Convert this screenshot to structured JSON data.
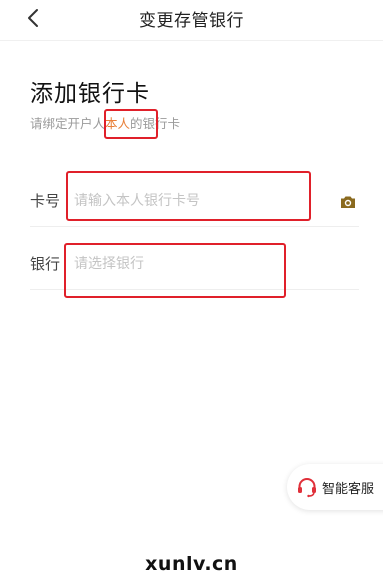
{
  "header": {
    "title": "变更存管银行",
    "back_icon": "chevron-left-icon"
  },
  "section": {
    "heading": "添加银行卡",
    "subtitle_prefix": "请绑定开户人",
    "subtitle_highlight": "本人",
    "subtitle_suffix": "的银行卡",
    "highlight_color": "#e8803a"
  },
  "form": {
    "card_label": "卡号",
    "card_placeholder": "请输入本人银行卡号",
    "card_value": "",
    "camera_icon": "camera-icon",
    "bank_label": "银行",
    "bank_placeholder": "请选择银行",
    "bank_value": ""
  },
  "service": {
    "label": "智能客服",
    "icon": "headset-icon",
    "accent": "#e0303a"
  },
  "annotations": {
    "color": "#e0202a"
  },
  "watermark": "xunlv.cn"
}
